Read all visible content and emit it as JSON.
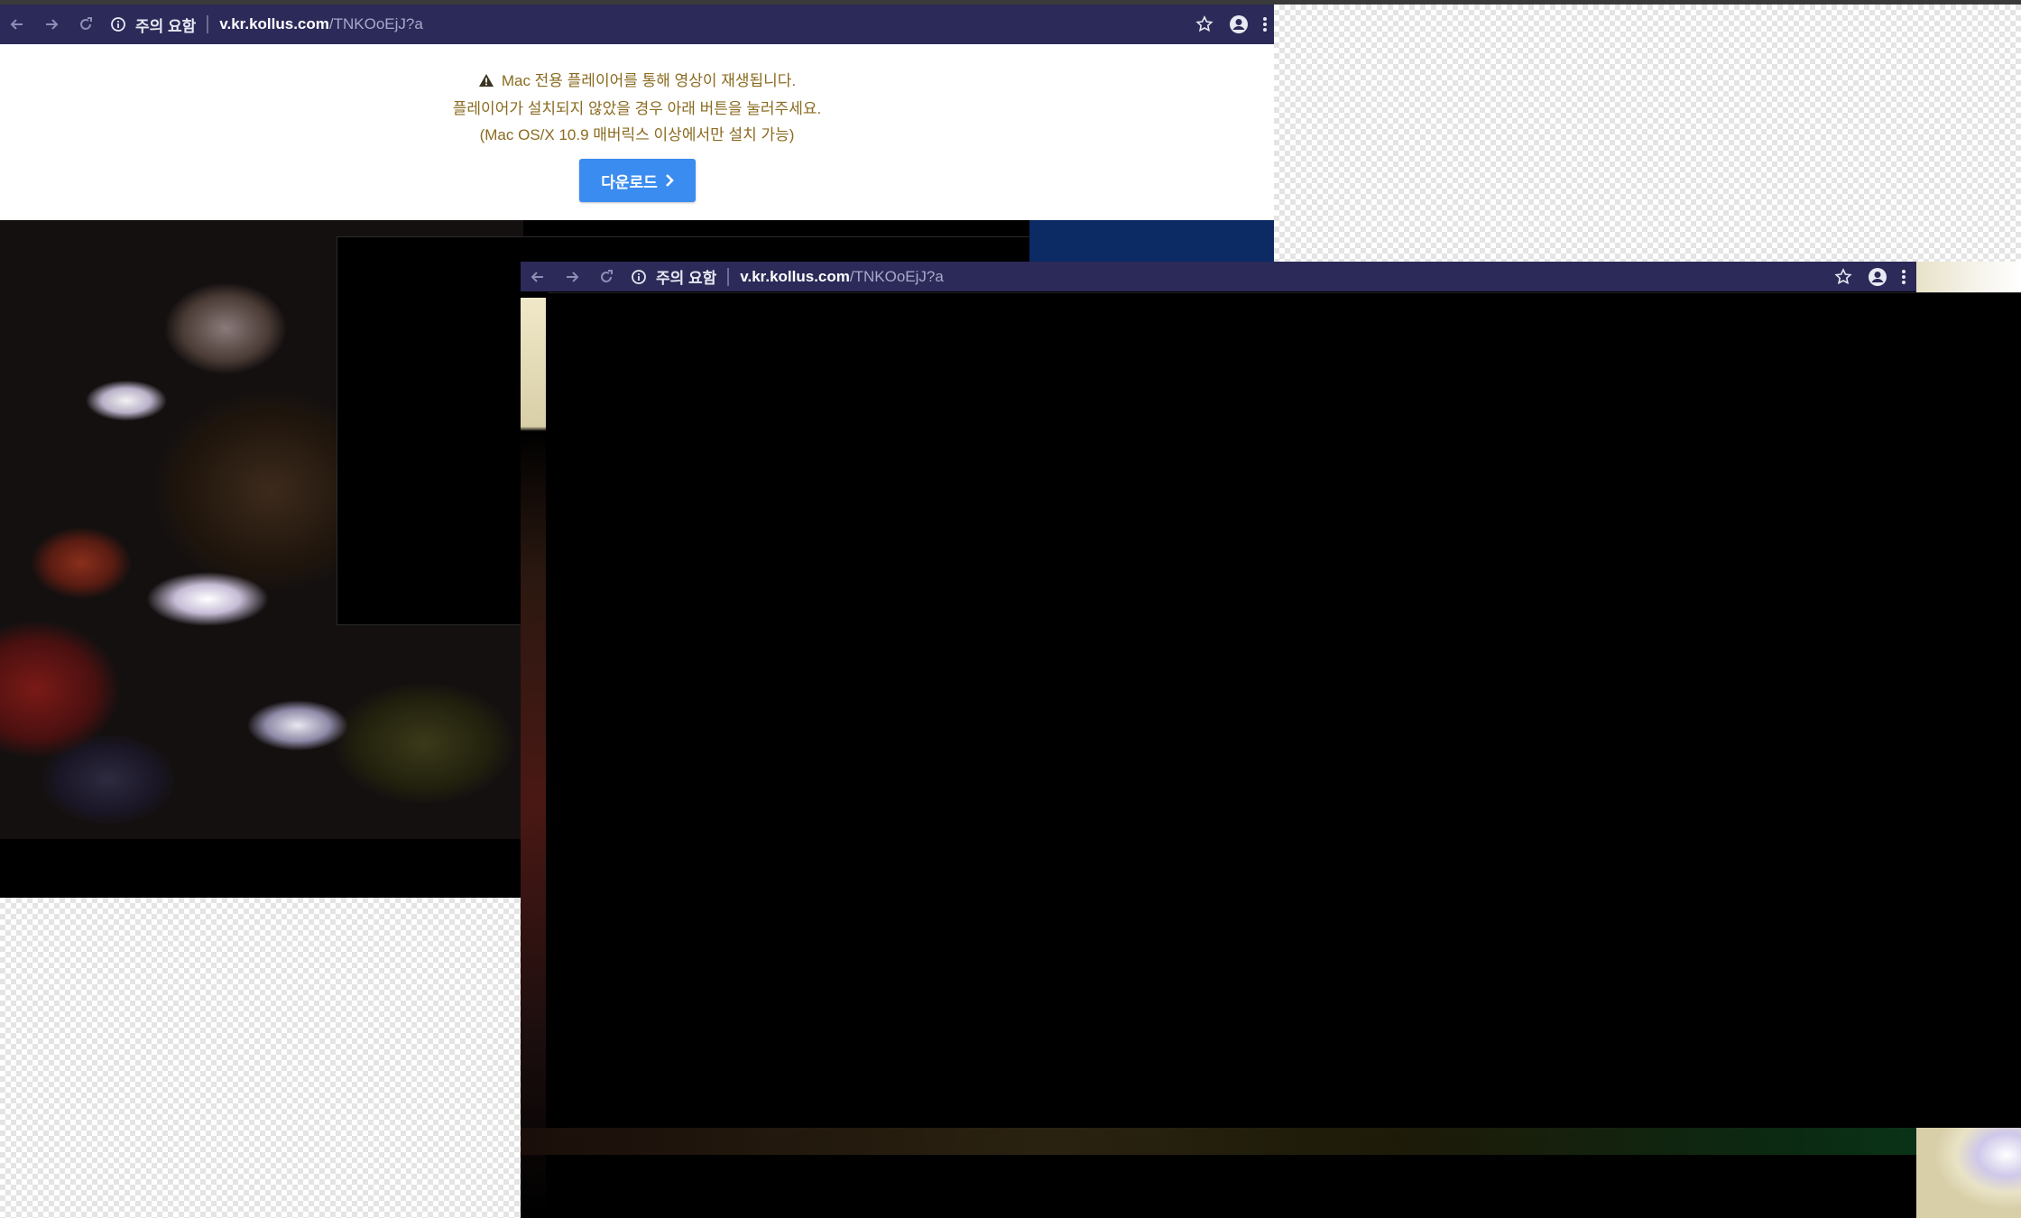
{
  "browser": {
    "security_label": "주의 요함",
    "url_host": "v.kr.kollus.com",
    "url_path": "/TNKOoEjJ?a"
  },
  "notice": {
    "line1": "Mac 전용 플레이어를 통해 영상이 재생됩니다.",
    "line2": "플레이어가 설치되지 않았을 경우 아래 버튼을 눌러주세요.",
    "line3": "(Mac OS/X 10.9 매버릭스 이상에서만 설치 가능)",
    "icon": "warning-triangle-icon"
  },
  "download_button": {
    "label": "다운로드",
    "icon": "chevron-right-icon"
  },
  "colors": {
    "toolbar_bg": "#2b2a58",
    "notice_text": "#8a6b20",
    "button_bg": "#3b8cf0"
  }
}
